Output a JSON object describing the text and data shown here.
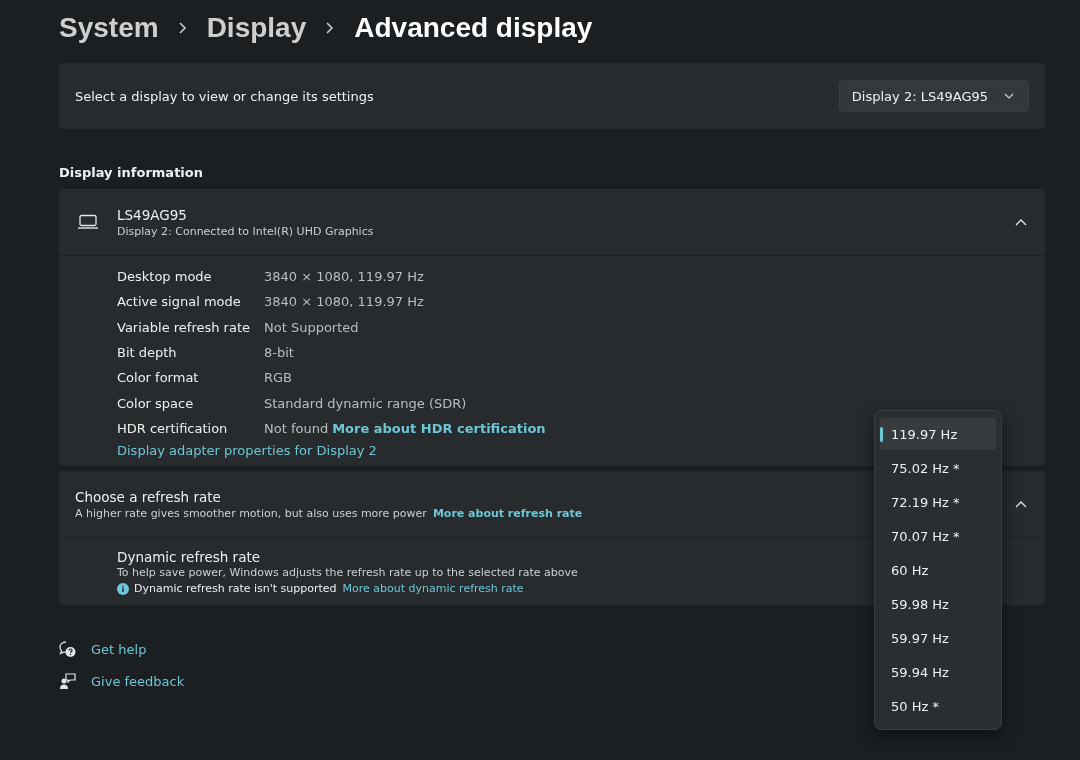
{
  "breadcrumb": [
    {
      "label": "System",
      "current": false
    },
    {
      "label": "Display",
      "current": false
    },
    {
      "label": "Advanced display",
      "current": true
    }
  ],
  "display_select": {
    "label": "Select a display to view or change its settings",
    "value": "Display 2: LS49AG95"
  },
  "display_info": {
    "heading": "Display information",
    "name": "LS49AG95",
    "subtitle": "Display 2: Connected to Intel(R) UHD Graphics",
    "expanded": true,
    "rows": [
      {
        "label": "Desktop mode",
        "value": "3840 × 1080, 119.97 Hz"
      },
      {
        "label": "Active signal mode",
        "value": "3840 × 1080, 119.97 Hz"
      },
      {
        "label": "Variable refresh rate",
        "value": "Not Supported"
      },
      {
        "label": "Bit depth",
        "value": "8-bit"
      },
      {
        "label": "Color format",
        "value": "RGB"
      },
      {
        "label": "Color space",
        "value": "Standard dynamic range (SDR)"
      },
      {
        "label": "HDR certification",
        "value": "Not found",
        "link": "More about HDR certification"
      }
    ],
    "adapter_link": "Display adapter properties for Display 2"
  },
  "refresh_rate": {
    "title": "Choose a refresh rate",
    "description": "A higher rate gives smoother motion, but also uses more power",
    "link": "More about refresh rate",
    "expanded": true,
    "dynamic": {
      "title": "Dynamic refresh rate",
      "description": "To help save power, Windows adjusts the refresh rate up to the selected rate above",
      "note": "Dynamic refresh rate isn't supported",
      "link": "More about dynamic refresh rate"
    },
    "options": [
      {
        "label": "119.97 Hz",
        "selected": true
      },
      {
        "label": "75.02 Hz *",
        "selected": false
      },
      {
        "label": "72.19 Hz *",
        "selected": false
      },
      {
        "label": "70.07 Hz *",
        "selected": false
      },
      {
        "label": "60 Hz",
        "selected": false
      },
      {
        "label": "59.98 Hz",
        "selected": false
      },
      {
        "label": "59.97 Hz",
        "selected": false
      },
      {
        "label": "59.94 Hz",
        "selected": false
      },
      {
        "label": "50 Hz *",
        "selected": false
      }
    ]
  },
  "footer_links": [
    {
      "kind": "help",
      "label": "Get help"
    },
    {
      "kind": "feedback",
      "label": "Give feedback"
    }
  ]
}
